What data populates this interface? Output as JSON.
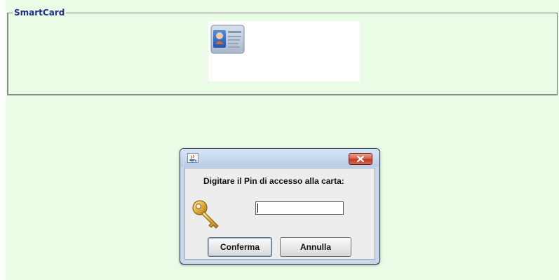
{
  "smartcard_panel": {
    "legend": "SmartCard",
    "card_icon": "id-card-icon"
  },
  "pin_dialog": {
    "title_icon": "java-app-icon",
    "close_icon": "close-icon",
    "prompt": "Digitare il Pin di accesso alla carta:",
    "key_icon": "key-icon",
    "pin_value": "",
    "confirm_label": "Conferma",
    "cancel_label": "Annulla"
  },
  "colors": {
    "page_background": "#eafbe6",
    "legend_text": "#1f2d86",
    "dialog_frame": "#c8d7ea",
    "close_button": "#c2361f",
    "key_gold": "#e2b13a"
  }
}
